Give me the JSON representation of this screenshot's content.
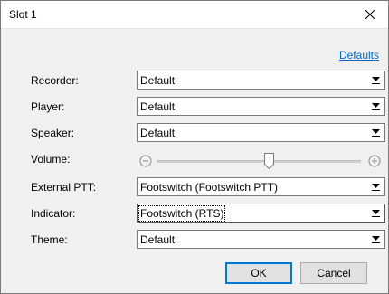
{
  "window": {
    "title": "Slot 1"
  },
  "defaults_link": "Defaults",
  "fields": {
    "recorder": {
      "label": "Recorder:",
      "value": "Default"
    },
    "player": {
      "label": "Player:",
      "value": "Default"
    },
    "speaker": {
      "label": "Speaker:",
      "value": "Default"
    },
    "volume": {
      "label": "Volume:",
      "level_fraction": 0.55
    },
    "external_ptt": {
      "label": "External PTT:",
      "value": "Footswitch (Footswitch PTT)"
    },
    "indicator": {
      "label": "Indicator:",
      "value": "Footswitch (RTS)"
    },
    "theme": {
      "label": "Theme:",
      "value": "Default"
    }
  },
  "buttons": {
    "ok": "OK",
    "cancel": "Cancel"
  },
  "icons": {
    "close": "close-icon",
    "dropdown": "chevron-down-icon",
    "volume_decrease": "minus-circle-icon",
    "volume_increase": "plus-circle-icon"
  }
}
